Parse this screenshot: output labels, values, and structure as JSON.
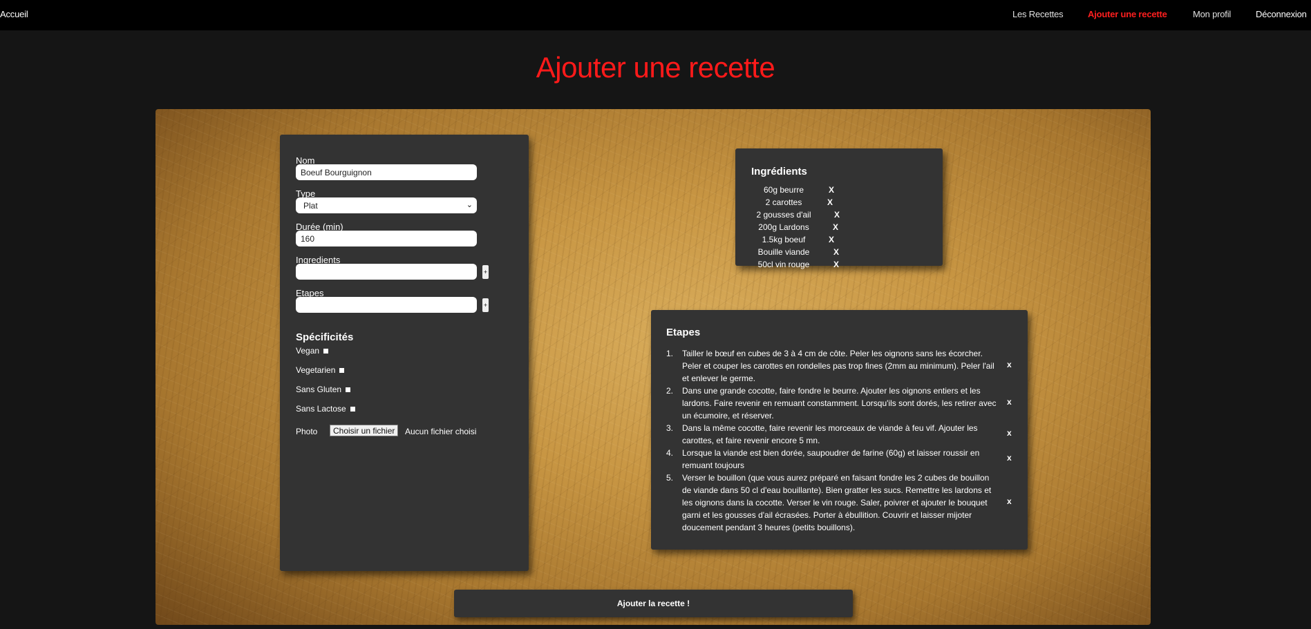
{
  "nav": {
    "home": "Accueil",
    "recipes": "Les Recettes",
    "add_recipe": "Ajouter une recette",
    "profile": "Mon profil",
    "logout": "Déconnexion"
  },
  "page_title": "Ajouter une recette",
  "form": {
    "name_label": "Nom",
    "name_value": "Boeuf Bourguignon",
    "type_label": "Type",
    "type_value": "Plat",
    "duration_label": "Durée (min)",
    "duration_value": "160",
    "ingredients_label": "Ingredients",
    "ingredients_value": "",
    "steps_label": "Etapes",
    "steps_value": "",
    "plus": "+",
    "specs_title": "Spécificités",
    "specs": [
      "Vegan",
      "Vegetarien",
      "Sans Gluten",
      "Sans Lactose"
    ],
    "photo_label": "Photo",
    "file_button": "Choisir un fichier",
    "file_status": "Aucun fichier choisi"
  },
  "ingredients": {
    "title": "Ingrédients",
    "remove_label": "X",
    "items": [
      "60g beurre",
      "2 carottes",
      "2 gousses d'ail",
      "200g Lardons",
      "1.5kg boeuf",
      "Bouille viande",
      "50cl vin rouge"
    ]
  },
  "steps": {
    "title": "Etapes",
    "remove_label": "x",
    "items": [
      "Tailler le bœuf en cubes de 3 à 4 cm de côte. Peler les oignons sans les écorcher. Peler et couper les carottes en rondelles pas trop fines (2mm au minimum). Peler l'ail et enlever le germe.",
      "Dans une grande cocotte, faire fondre le beurre. Ajouter les oignons entiers et les lardons. Faire revenir en remuant constamment. Lorsqu'ils sont dorés, les retirer avec un écumoire, et réserver.",
      "Dans la même cocotte, faire revenir les morceaux de viande à feu vif. Ajouter les carottes, et faire revenir encore 5 mn.",
      "Lorsque la viande est bien dorée, saupoudrer de farine (60g) et laisser roussir en remuant toujours",
      "Verser le bouillon (que vous aurez préparé en faisant fondre les 2 cubes de bouillon de viande dans 50 cl d'eau bouillante). Bien gratter les sucs. Remettre les lardons et les oignons dans la cocotte. Verser le vin rouge. Saler, poivrer et ajouter le bouquet garni et les gousses d'ail écrasées. Porter à ébullition. Couvrir et laisser mijoter doucement pendant 3 heures (petits bouillons)."
    ]
  },
  "submit_label": "Ajouter la recette !"
}
